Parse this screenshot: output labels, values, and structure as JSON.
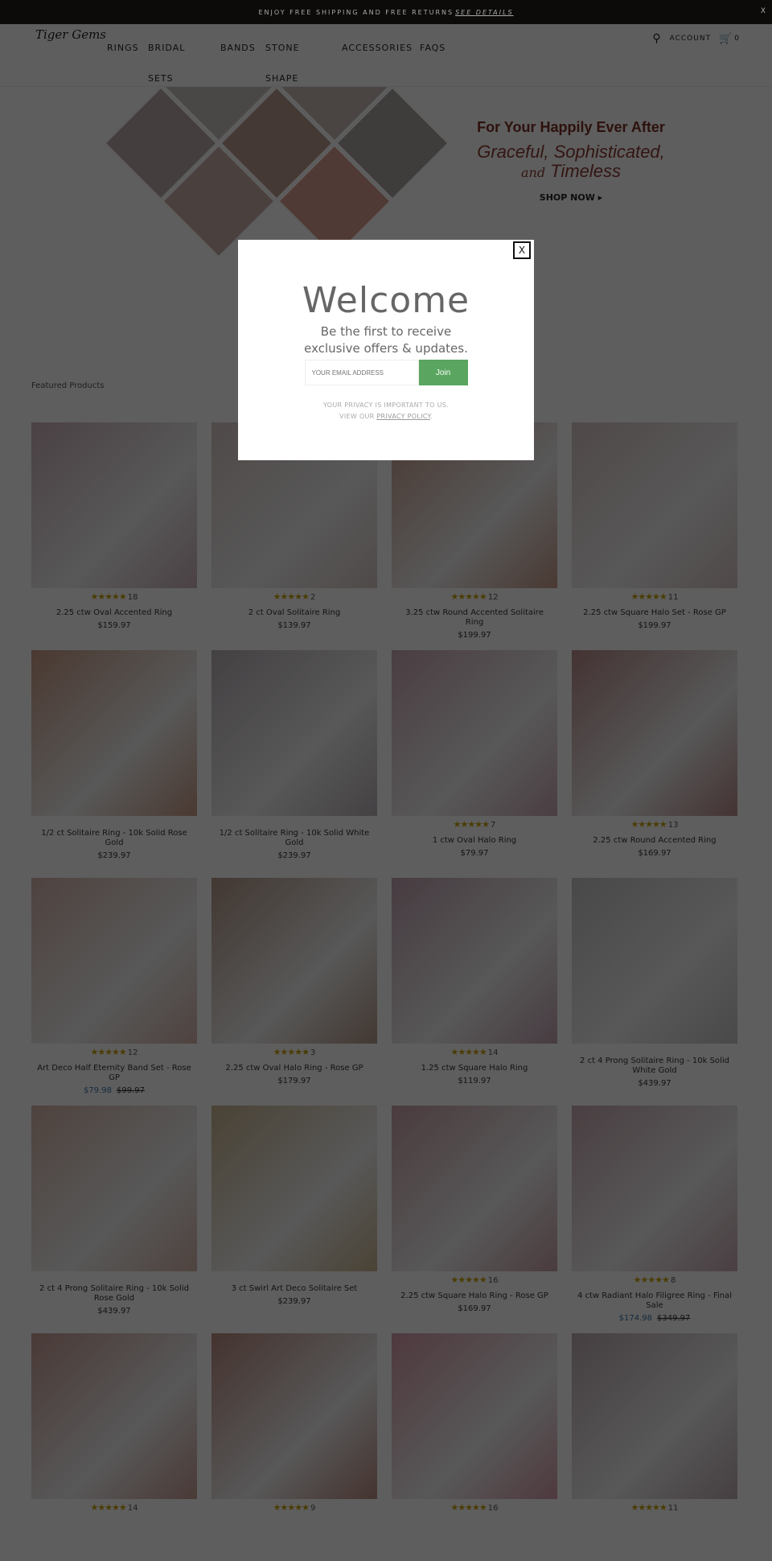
{
  "announcement": {
    "text": "ENJOY FREE SHIPPING AND FREE RETURNS",
    "link": "SEE DETAILS",
    "close": "X"
  },
  "header": {
    "logo": "Tiger Gems",
    "nav": [
      "RINGS",
      "BRIDAL",
      "SETS",
      "BANDS",
      "STONE",
      "SHAPE",
      "ACCESSORIES",
      "FAQS"
    ],
    "account": "ACCOUNT",
    "cart_count": "0"
  },
  "hero": {
    "headline": "For Your Happily Ever After",
    "line2": "Graceful, Sophisticated,",
    "line3_and": "and",
    "line3": "Timeless",
    "cta": "SHOP NOW ▸"
  },
  "featured_label": "Featured Products",
  "colors": {
    "rating": "#c9a10a",
    "sale": "#3b75a8",
    "join": "#5aa55f"
  },
  "products": [
    {
      "name": "2.25 ctw Oval Accented Ring",
      "price": "$159.97",
      "rating": "18",
      "img": "#c9b0b8"
    },
    {
      "name": "2 ct Oval Solitaire Ring",
      "price": "$139.97",
      "rating": "2",
      "img": "#d6c8c4"
    },
    {
      "name": "3.25 ctw Round Accented Solitaire Ring",
      "price": "$199.97",
      "rating": "12",
      "img": "#c69a8a"
    },
    {
      "name": "2.25 ctw Square Halo Set - Rose GP",
      "price": "$199.97",
      "rating": "11",
      "img": "#d8c4c4"
    },
    {
      "name": "1/2 ct Solitaire Ring - 10k Solid Rose Gold",
      "price": "$239.97",
      "rating": "",
      "img": "#c89a84"
    },
    {
      "name": "1/2 ct Solitaire Ring - 10k Solid White Gold",
      "price": "$239.97",
      "rating": "",
      "img": "#b8b0b6"
    },
    {
      "name": "1 ctw Oval Halo Ring",
      "price": "$79.97",
      "rating": "7",
      "img": "#c9a7b2"
    },
    {
      "name": "2.25 ctw Round Accented Ring",
      "price": "$169.97",
      "rating": "13",
      "img": "#b88a8a"
    },
    {
      "name": "Art Deco Half Eternity Band Set - Rose GP",
      "price": "$79.98",
      "was": "$99.97",
      "rating": "12",
      "img": "#d4b4aa"
    },
    {
      "name": "2.25 ctw Oval Halo Ring - Rose GP",
      "price": "$179.97",
      "rating": "3",
      "img": "#b39888"
    },
    {
      "name": "1.25 ctw Square Halo Ring",
      "price": "$119.97",
      "rating": "14",
      "img": "#c0a2b0"
    },
    {
      "name": "2 ct 4 Prong Solitaire Ring - 10k Solid White Gold",
      "price": "$439.97",
      "rating": "",
      "img": "#c8c4c6"
    },
    {
      "name": "2 ct 4 Prong Solitaire Ring - 10k Solid Rose Gold",
      "price": "$439.97",
      "rating": "",
      "img": "#d4b4a8"
    },
    {
      "name": "3 ct Swirl Art Deco Solitaire Set",
      "price": "$239.97",
      "rating": "",
      "img": "#c8b490"
    },
    {
      "name": "2.25 ctw Square Halo Ring - Rose GP",
      "price": "$169.97",
      "rating": "16",
      "img": "#c8a0a8"
    },
    {
      "name": "4 ctw Radiant Halo Filigree Ring - Final Sale",
      "price": "$174.98",
      "was": "$349.97",
      "rating": "8",
      "img": "#c8aab2"
    },
    {
      "name": "",
      "price": "",
      "rating": "14",
      "img": "#c69c94"
    },
    {
      "name": "",
      "price": "",
      "rating": "9",
      "img": "#b88a80"
    },
    {
      "name": "",
      "price": "",
      "rating": "16",
      "img": "#d49aa8"
    },
    {
      "name": "",
      "price": "",
      "rating": "11",
      "img": "#bcaab0"
    }
  ],
  "modal": {
    "close": "X",
    "title": "Welcome",
    "subtitle1": "Be the first to receive",
    "subtitle2": "exclusive offers & updates.",
    "email_placeholder": "YOUR EMAIL ADDRESS",
    "join": "Join",
    "privacy1": "YOUR PRIVACY IS IMPORTANT TO US.",
    "privacy2": "VIEW OUR",
    "privacy_link": "PRIVACY POLICY"
  }
}
